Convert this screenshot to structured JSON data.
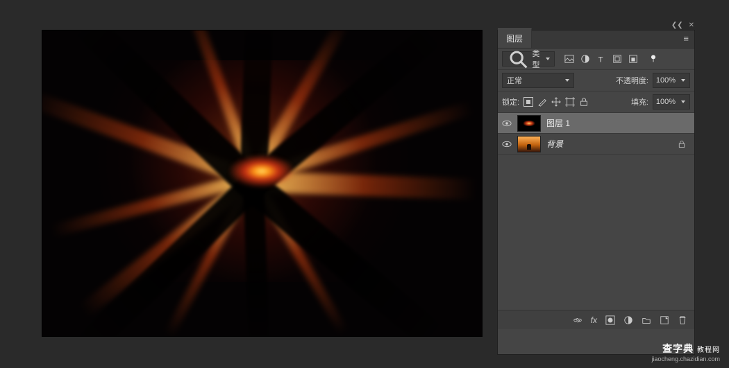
{
  "panel": {
    "tab_label": "图层",
    "filter_type_label": "类型",
    "blend_mode": "正常",
    "opacity_label": "不透明度:",
    "opacity_value": "100%",
    "lock_label": "锁定:",
    "fill_label": "填充:",
    "fill_value": "100%",
    "menu_glyph": "≡",
    "collapse_glyph": "❮❮",
    "close_glyph": "✕"
  },
  "filter_icons": [
    "image-icon",
    "adjustment-icon",
    "type-icon",
    "shape-icon",
    "smart-icon",
    "artboard-icon"
  ],
  "layers": [
    {
      "name": "图层 1",
      "selected": true,
      "locked": false,
      "thumb": "fx"
    },
    {
      "name": "背景",
      "selected": false,
      "locked": true,
      "thumb": "bg"
    }
  ],
  "footer_icons": [
    "link-icon",
    "fx-icon",
    "mask-icon",
    "adjustment-circle-icon",
    "group-icon",
    "new-layer-icon",
    "trash-icon"
  ],
  "watermark": {
    "line1_cn": "查字典",
    "line1_tag": "教程网",
    "line2": "jiaocheng.chazidian.com"
  }
}
